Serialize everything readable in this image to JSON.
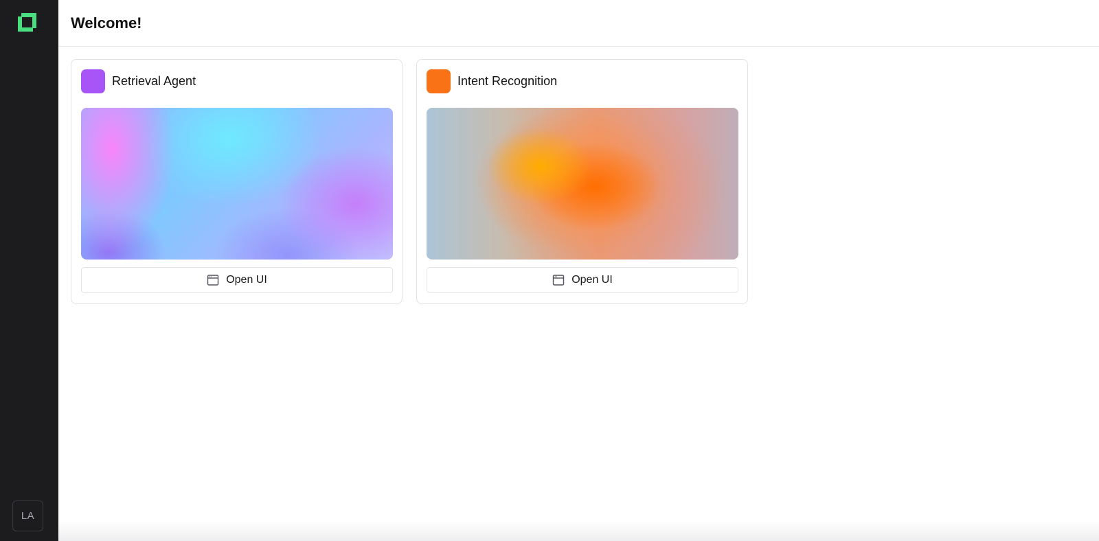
{
  "sidebar": {
    "logo_icon": "app-logo-icon",
    "logo_color": "#4ade80",
    "avatar_initials": "LA"
  },
  "header": {
    "title": "Welcome!"
  },
  "cards": [
    {
      "title": "Retrieval Agent",
      "swatch_color": "#a855f7",
      "button_label": "Open UI",
      "button_icon": "browser-window-icon"
    },
    {
      "title": "Intent Recognition",
      "swatch_color": "#f97316",
      "button_label": "Open UI",
      "button_icon": "browser-window-icon"
    }
  ]
}
